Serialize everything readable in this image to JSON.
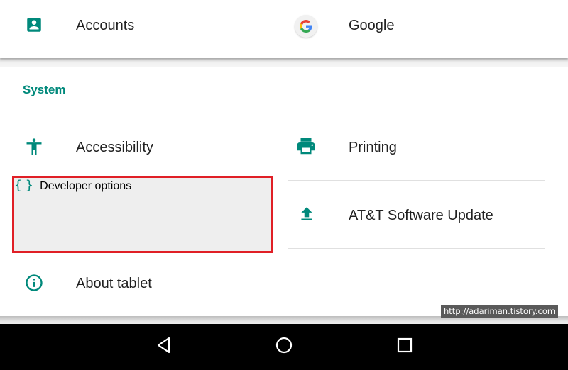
{
  "top_section": {
    "items": [
      {
        "label": "Accounts",
        "icon": "account-box-icon"
      },
      {
        "label": "Google",
        "icon": "google-g-icon"
      }
    ]
  },
  "system_section": {
    "title": "System",
    "items": [
      {
        "label": "Accessibility",
        "icon": "accessibility-icon"
      },
      {
        "label": "Printing",
        "icon": "printer-icon"
      },
      {
        "label": "Developer options",
        "icon": "braces-icon",
        "highlighted": true
      },
      {
        "label": "AT&T Software Update",
        "icon": "upload-icon"
      },
      {
        "label": "About tablet",
        "icon": "info-icon"
      }
    ]
  },
  "nav_bar": {
    "buttons": [
      "back-icon",
      "home-icon",
      "recents-icon"
    ]
  },
  "watermark": "http://adariman.tistory.com",
  "colors": {
    "accent": "#00897b",
    "highlight_border": "#e01f26",
    "highlight_bg": "#eeeeee",
    "nav_bg": "#000000"
  }
}
